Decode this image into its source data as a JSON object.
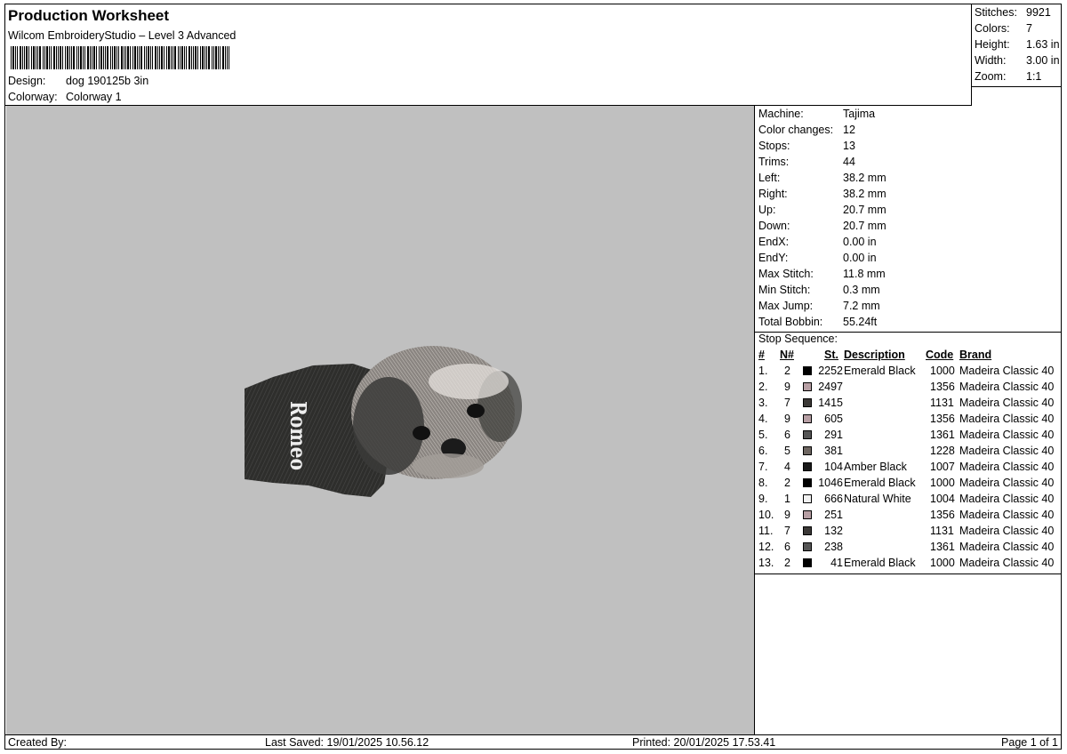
{
  "header": {
    "title": "Production Worksheet",
    "subtitle": "Wilcom EmbroideryStudio – Level 3 Advanced",
    "design_label": "Design:",
    "design_value": "dog 190125b 3in",
    "colorway_label": "Colorway:",
    "colorway_value": "Colorway 1"
  },
  "summary": [
    {
      "label": "Stitches:",
      "value": "9921"
    },
    {
      "label": "Colors:",
      "value": "7"
    },
    {
      "label": "Height:",
      "value": "1.63 in"
    },
    {
      "label": "Width:",
      "value": "3.00 in"
    },
    {
      "label": "Zoom:",
      "value": "1:1"
    }
  ],
  "preview": {
    "embroidered_text": "Romeo",
    "background_color": "#c0c0c0"
  },
  "machine_info": [
    {
      "label": "Machine:",
      "value": "Tajima"
    },
    {
      "label": "Color changes:",
      "value": "12"
    },
    {
      "label": "Stops:",
      "value": "13"
    },
    {
      "label": "Trims:",
      "value": "44"
    },
    {
      "label": "Left:",
      "value": "38.2 mm"
    },
    {
      "label": "Right:",
      "value": "38.2 mm"
    },
    {
      "label": "Up:",
      "value": "20.7 mm"
    },
    {
      "label": "Down:",
      "value": "20.7 mm"
    },
    {
      "label": "EndX:",
      "value": "0.00 in"
    },
    {
      "label": "EndY:",
      "value": "0.00 in"
    },
    {
      "label": "Max Stitch:",
      "value": "11.8 mm"
    },
    {
      "label": "Min Stitch:",
      "value": "0.3 mm"
    },
    {
      "label": "Max Jump:",
      "value": "7.2 mm"
    },
    {
      "label": "Total Bobbin:",
      "value": "55.24ft"
    }
  ],
  "stop_sequence": {
    "title": "Stop Sequence:",
    "headers": {
      "num": "#",
      "n": "N#",
      "st": "St.",
      "description": "Description",
      "code": "Code",
      "brand": "Brand"
    },
    "rows": [
      {
        "num": "1.",
        "n": "2",
        "color": "#000000",
        "st": "2252",
        "description": "Emerald Black",
        "code": "1000",
        "brand": "Madeira Classic 40"
      },
      {
        "num": "2.",
        "n": "9",
        "color": "#b79fa4",
        "st": "2497",
        "description": "",
        "code": "1356",
        "brand": "Madeira Classic 40"
      },
      {
        "num": "3.",
        "n": "7",
        "color": "#3b3836",
        "st": "1415",
        "description": "",
        "code": "1131",
        "brand": "Madeira Classic 40"
      },
      {
        "num": "4.",
        "n": "9",
        "color": "#b79fa4",
        "st": "605",
        "description": "",
        "code": "1356",
        "brand": "Madeira Classic 40"
      },
      {
        "num": "5.",
        "n": "6",
        "color": "#555555",
        "st": "291",
        "description": "",
        "code": "1361",
        "brand": "Madeira Classic 40"
      },
      {
        "num": "6.",
        "n": "5",
        "color": "#6e6661",
        "st": "381",
        "description": "",
        "code": "1228",
        "brand": "Madeira Classic 40"
      },
      {
        "num": "7.",
        "n": "4",
        "color": "#1a1a1a",
        "st": "104",
        "description": "Amber Black",
        "code": "1007",
        "brand": "Madeira Classic 40"
      },
      {
        "num": "8.",
        "n": "2",
        "color": "#000000",
        "st": "1046",
        "description": "Emerald Black",
        "code": "1000",
        "brand": "Madeira Classic 40"
      },
      {
        "num": "9.",
        "n": "1",
        "color": "#f2f2f2",
        "st": "666",
        "description": "Natural White",
        "code": "1004",
        "brand": "Madeira Classic 40"
      },
      {
        "num": "10.",
        "n": "9",
        "color": "#b79fa4",
        "st": "251",
        "description": "",
        "code": "1356",
        "brand": "Madeira Classic 40"
      },
      {
        "num": "11.",
        "n": "7",
        "color": "#3b3836",
        "st": "132",
        "description": "",
        "code": "1131",
        "brand": "Madeira Classic 40"
      },
      {
        "num": "12.",
        "n": "6",
        "color": "#555555",
        "st": "238",
        "description": "",
        "code": "1361",
        "brand": "Madeira Classic 40"
      },
      {
        "num": "13.",
        "n": "2",
        "color": "#000000",
        "st": "41",
        "description": "Emerald Black",
        "code": "1000",
        "brand": "Madeira Classic 40"
      }
    ]
  },
  "footer": {
    "created_by": "Created By:",
    "last_saved": "Last Saved: 19/01/2025 10.56.12",
    "printed": "Printed: 20/01/2025 17.53.41",
    "page": "Page 1 of 1"
  }
}
